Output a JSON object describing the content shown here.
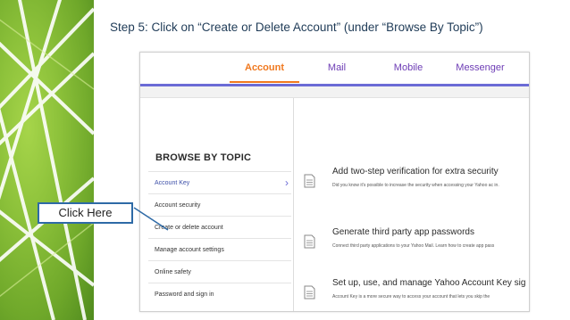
{
  "slide": {
    "title": "Step 5: Click on “Create or Delete Account” (under “Browse By Topic”)"
  },
  "tabs": [
    {
      "label": "Account",
      "active": true
    },
    {
      "label": "Mail",
      "active": false
    },
    {
      "label": "Mobile",
      "active": false
    },
    {
      "label": "Messenger",
      "active": false
    }
  ],
  "browse": {
    "heading": "BROWSE BY TOPIC",
    "items": [
      {
        "label": "Account Key",
        "active": true
      },
      {
        "label": "Account security"
      },
      {
        "label": "Create or delete account"
      },
      {
        "label": "Manage account settings"
      },
      {
        "label": "Online safety"
      },
      {
        "label": "Password and sign in"
      }
    ]
  },
  "articles": [
    {
      "title": "Add two-step verification for extra security",
      "desc": "Did you know it's possible to increase the security when accessing your Yahoo ac in."
    },
    {
      "title": "Generate third party app passwords",
      "desc": "Connect third party applications to your Yahoo Mail. Learn how to create app pass"
    },
    {
      "title": "Set up, use, and manage Yahoo Account Key sig",
      "desc": "Account Key is a more secure way to access your account that lets you skip the"
    }
  ],
  "callout": {
    "label": "Click Here"
  },
  "colors": {
    "accent_orange": "#f0781e",
    "tab_purple": "#6d3cb5",
    "bar_purple": "#6b6bd6",
    "callout_border": "#2e6aa6",
    "deco_green": "#8cc13a"
  }
}
